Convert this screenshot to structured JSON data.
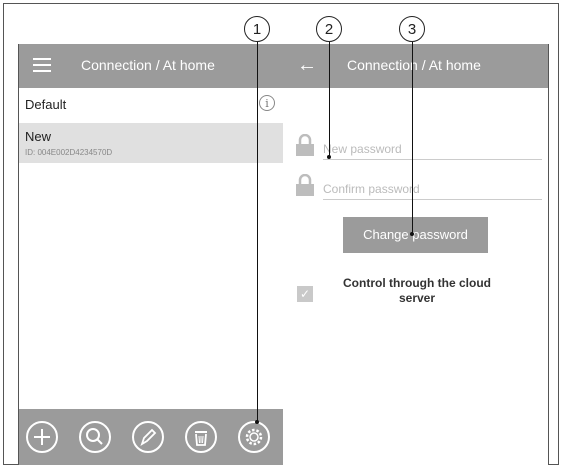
{
  "left_screen": {
    "header_title": "Connection / At home",
    "items": [
      {
        "label": "Default"
      },
      {
        "label": "New",
        "id": "ID: 004E002D4234570D"
      }
    ],
    "info_icon_glyph": "i",
    "bottom_icons": [
      "add-icon",
      "search-icon",
      "edit-icon",
      "delete-icon",
      "settings-icon"
    ]
  },
  "right_screen": {
    "header_title": "Connection / At home",
    "new_password_placeholder": "New password",
    "confirm_password_placeholder": "Confirm password",
    "change_password_label": "Change password",
    "cloud_label": "Control through the cloud server",
    "cloud_checked": true
  },
  "callouts": [
    "1",
    "2",
    "3"
  ],
  "colors": {
    "bar": "#9b9b9b",
    "selected_row": "#e0e0e0"
  }
}
